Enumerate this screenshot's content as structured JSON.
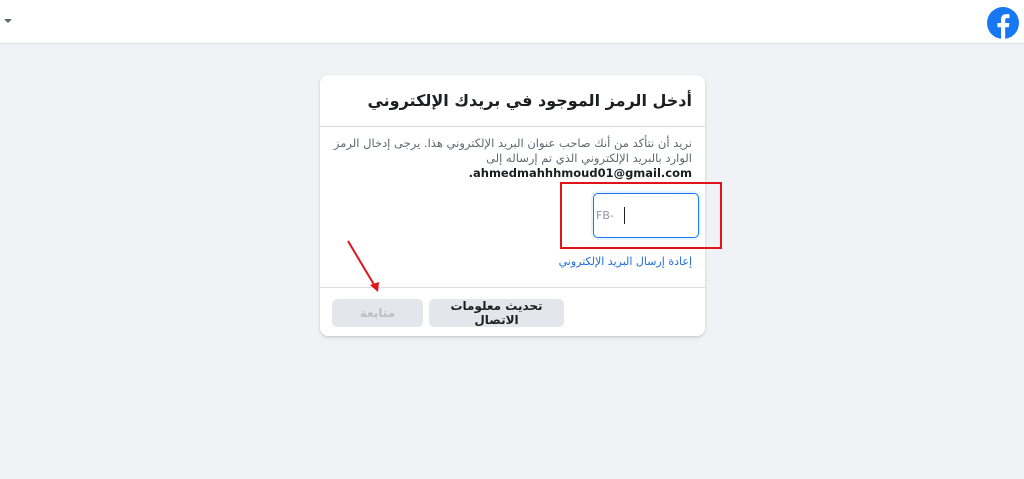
{
  "header": {
    "logo_icon": "facebook-logo-icon",
    "menu_icon": "caret-down-icon",
    "brand_color": "#1877f2"
  },
  "card": {
    "title": "أدخل الرمز الموجود في بريدك الإلكتروني",
    "description": "نريد أن نتأكد من أنك صاحب عنوان البريد الإلكتروني هذا. يرجى إدخال الرمز الوارد بالبريد الإلكتروني الذي تم إرساله إلى",
    "email": "ahmedmahhhmoud01@gmail.com.",
    "code_prefix": "FB-",
    "code_value": "",
    "resend_link": "إعادة إرسال البريد الإلكتروني",
    "update_button": "تحديث معلومات الاتصال",
    "continue_button": "متابعة"
  },
  "annotation": {
    "highlight_color": "#e0141b",
    "arrow_icon": "red-arrow-icon"
  }
}
